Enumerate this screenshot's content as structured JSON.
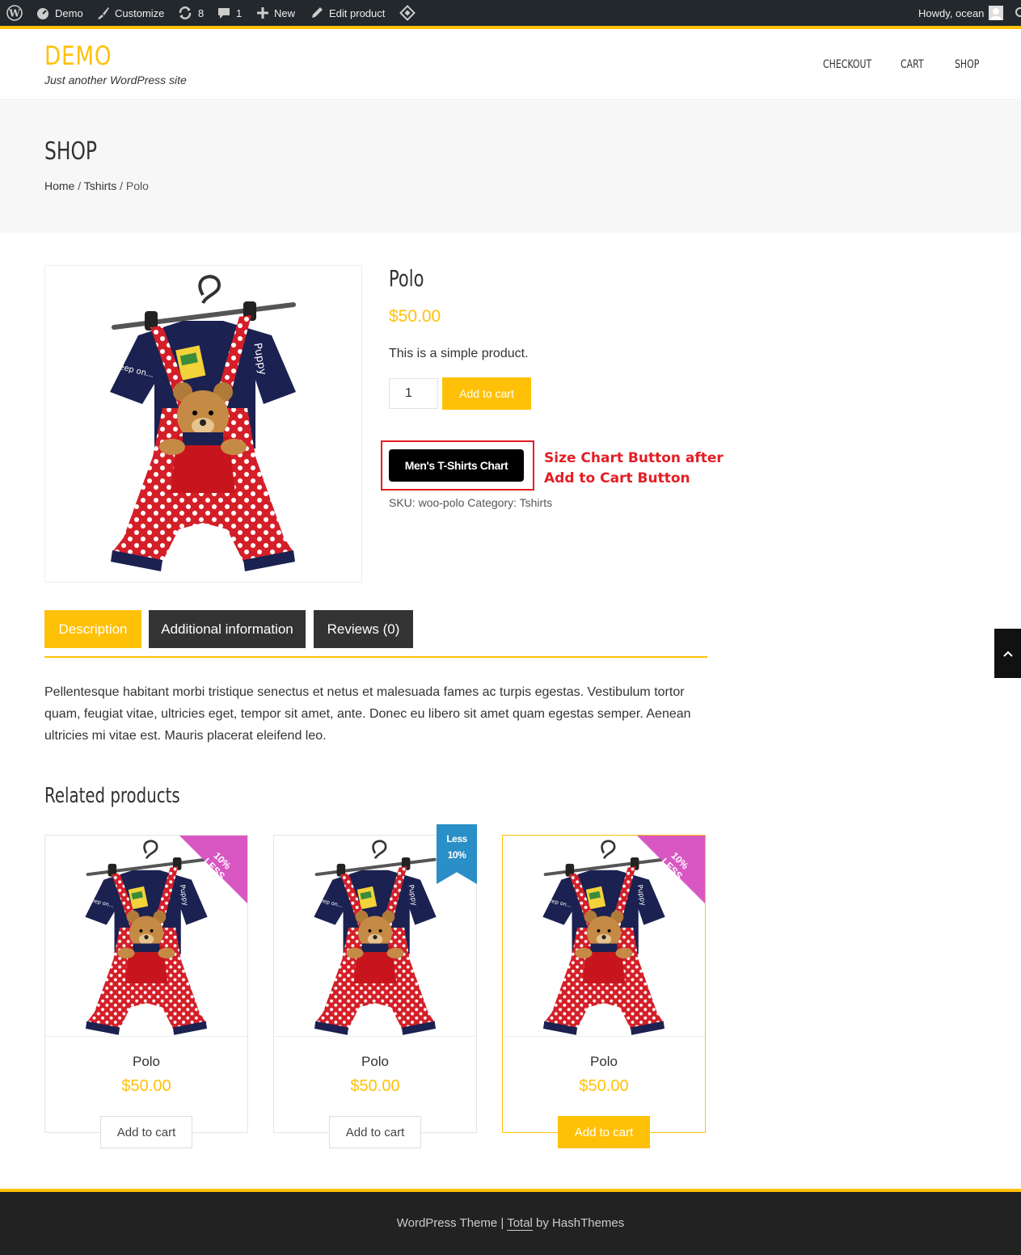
{
  "admin_bar": {
    "site": "Demo",
    "customize": "Customize",
    "updates": "8",
    "comments": "1",
    "new": "New",
    "edit": "Edit product",
    "greeting": "Howdy, ocean"
  },
  "site": {
    "title": "DEMO",
    "tagline": "Just another WordPress site"
  },
  "nav": {
    "items": [
      "CHECKOUT",
      "CART",
      "SHOP"
    ]
  },
  "page": {
    "title": "SHOP",
    "breadcrumb": {
      "home": "Home",
      "sep1": " / ",
      "category": "Tshirts",
      "sep2": " / ",
      "current": "Polo"
    }
  },
  "product": {
    "title": "Polo",
    "price": "$50.00",
    "short_description": "This is a simple product.",
    "quantity": "1",
    "add_to_cart": "Add to cart",
    "size_chart_button": "Men's T-Shirts Chart",
    "annotation_line1": "Size Chart Button after",
    "annotation_line2": "Add to Cart Button",
    "sku_label": "SKU:",
    "sku": "woo-polo",
    "category_label": "Category:",
    "category": "Tshirts"
  },
  "tabs": {
    "description": "Description",
    "additional": "Additional information",
    "reviews": "Reviews (0)"
  },
  "description_text": "Pellentesque habitant morbi tristique senectus et netus et malesuada fames ac turpis egestas. Vestibulum tortor quam, feugiat vitae, ultricies eget, tempor sit amet, ante. Donec eu libero sit amet quam egestas semper. Aenean ultricies mi vitae est. Mauris placerat eleifend leo.",
  "related": {
    "title": "Related products",
    "products": [
      {
        "name": "Polo",
        "price": "$50.00",
        "button": "Add to cart",
        "badge_line1": "10%",
        "badge_line2": "LESS"
      },
      {
        "name": "Polo",
        "price": "$50.00",
        "button": "Add to cart",
        "badge_line1": "Less",
        "badge_line2": "10%"
      },
      {
        "name": "Polo",
        "price": "$50.00",
        "button": "Add to cart",
        "badge_line1": "10%",
        "badge_line2": "LESS"
      }
    ]
  },
  "footer": {
    "prefix": "WordPress Theme | ",
    "theme": "Total",
    "suffix": " by HashThemes"
  },
  "colors": {
    "accent": "#ffc107",
    "admin_bar": "#23282d",
    "annotation_red": "#e31e24",
    "badge_pink": "#d857c3",
    "badge_blue": "#2a8fc6",
    "footer": "#222222"
  }
}
